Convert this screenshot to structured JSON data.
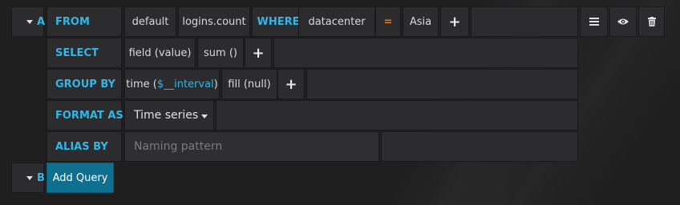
{
  "query_a": {
    "ref_id": "A",
    "rows": {
      "from": {
        "label": "FROM",
        "policy": "default",
        "measurement": "logins.count",
        "where_keyword": "WHERE",
        "tag_key": "datacenter",
        "operator": "=",
        "tag_value": "Asia",
        "add": "+"
      },
      "select": {
        "label": "SELECT",
        "field": "field (value)",
        "aggregation": "sum ()",
        "add": "+"
      },
      "group_by": {
        "label": "GROUP BY",
        "time_prefix": "time (",
        "time_var": "$__interval",
        "time_suffix": ")",
        "fill": "fill (null)",
        "add": "+"
      },
      "format_as": {
        "label": "FORMAT AS",
        "value": "Time series"
      },
      "alias_by": {
        "label": "ALIAS BY",
        "placeholder": "Naming pattern"
      }
    },
    "actions": {
      "menu_icon": "hamburger-icon",
      "toggle_icon": "eye-icon",
      "delete_icon": "trash-icon"
    }
  },
  "query_b": {
    "ref_id": "B"
  },
  "add_query_label": "Add Query",
  "colors": {
    "background": "#1f1f20",
    "box": "#2c2c2e",
    "label_blue": "#33b5e5",
    "operator_orange": "#eb7b18",
    "primary_button": "#0f6f8f"
  }
}
